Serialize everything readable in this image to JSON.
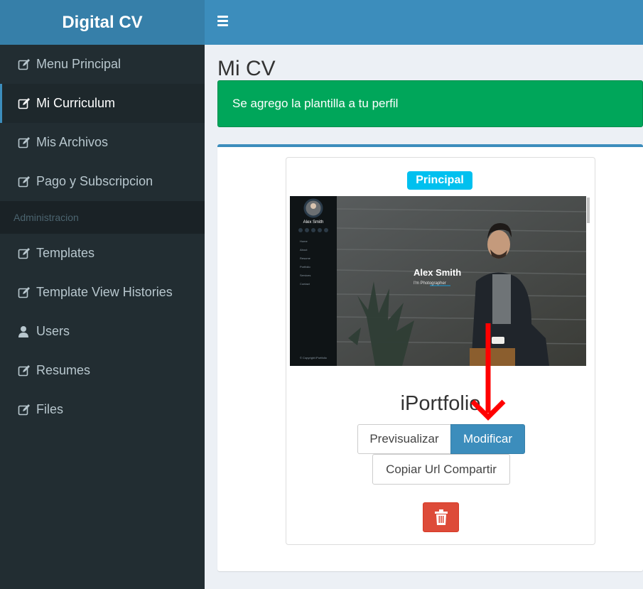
{
  "app": {
    "title": "Digital CV"
  },
  "sidebar": {
    "items": [
      {
        "label": "Menu Principal",
        "icon": "edit-icon"
      },
      {
        "label": "Mi Curriculum",
        "icon": "edit-icon",
        "active": true
      },
      {
        "label": "Mis Archivos",
        "icon": "edit-icon"
      },
      {
        "label": "Pago y Subscripcion",
        "icon": "edit-icon"
      }
    ],
    "admin_header": "Administracion",
    "admin_items": [
      {
        "label": "Templates",
        "icon": "edit-icon"
      },
      {
        "label": "Template View Histories",
        "icon": "edit-icon"
      },
      {
        "label": "Users",
        "icon": "user-icon"
      },
      {
        "label": "Resumes",
        "icon": "edit-icon"
      },
      {
        "label": "Files",
        "icon": "edit-icon"
      }
    ]
  },
  "main": {
    "page_title": "Mi CV",
    "alert": "Se agrego la plantilla a tu perfil",
    "template_card": {
      "badge": "Principal",
      "name": "iPortfolio",
      "preview": {
        "person_name": "Alex Smith",
        "subtitle": "I'm Photographer",
        "menu": [
          "Home",
          "About",
          "Resume",
          "Portfolio",
          "Services",
          "Contact"
        ],
        "footer": "© Copyright iPortfolio"
      },
      "buttons": {
        "preview": "Previsualizar",
        "modify": "Modificar",
        "copy_url": "Copiar Url Compartir",
        "delete_icon": "trash-icon"
      }
    }
  },
  "colors": {
    "brand": "#367fa9",
    "topbar": "#3c8dbc",
    "sidebar": "#222d32",
    "success": "#00a65a",
    "info": "#00c0ef",
    "danger": "#dd4b39",
    "arrow": "#ff0000"
  }
}
